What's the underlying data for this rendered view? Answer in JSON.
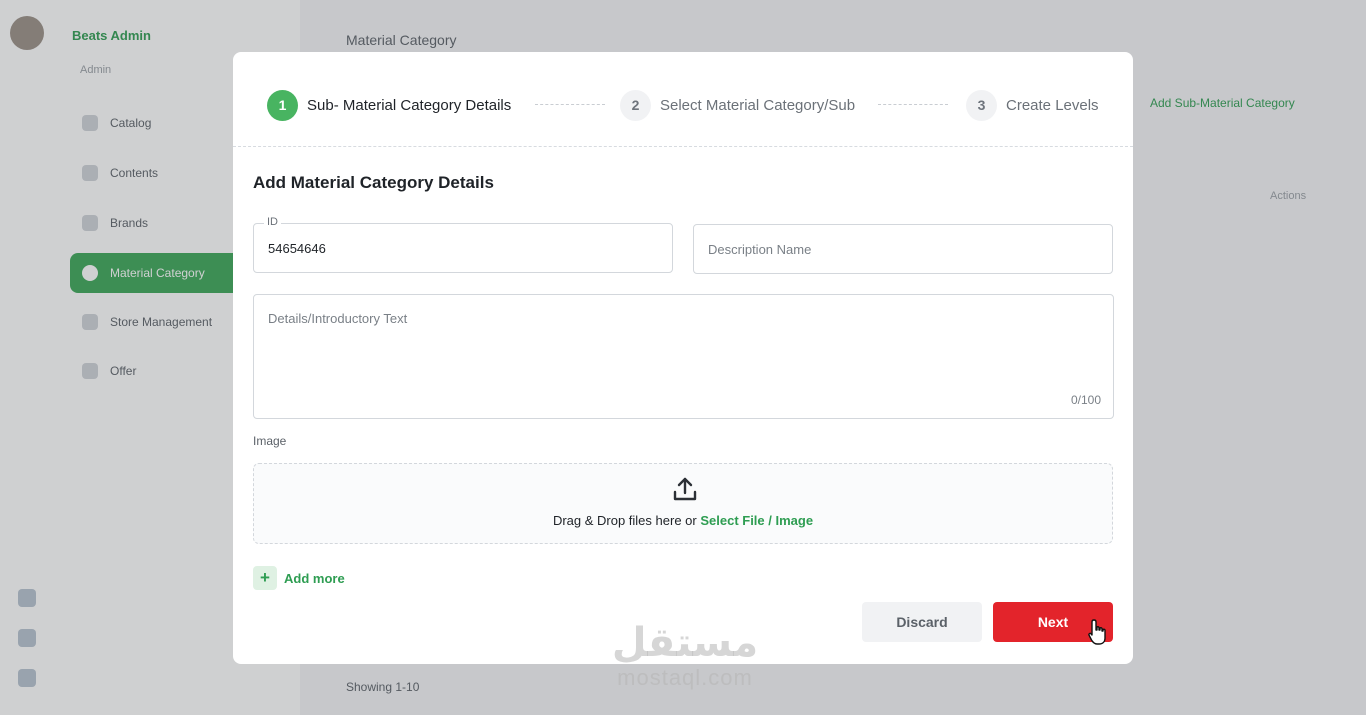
{
  "background": {
    "brand": "Beats Admin",
    "subtitle": "Admin",
    "nav": [
      {
        "label": "Catalog"
      },
      {
        "label": "Contents"
      },
      {
        "label": "Brands"
      },
      {
        "label": "Material Category"
      },
      {
        "label": "Store Management"
      },
      {
        "label": "Offer"
      }
    ],
    "main_title": "Material Category",
    "main_button": "Add Sub-Material Category",
    "main_field": "Actions",
    "footer": "Showing 1-10"
  },
  "stepper": {
    "steps": [
      {
        "number": "1",
        "label": "Sub- Material Category Details"
      },
      {
        "number": "2",
        "label": "Select Material Category/Sub"
      },
      {
        "number": "3",
        "label": "Create Levels"
      }
    ],
    "active_step": 1
  },
  "form": {
    "title": "Add Material Category Details",
    "id_label": "ID",
    "id_value": "54654646",
    "description_placeholder": "Description Name",
    "details_placeholder": "Details/Introductory Text",
    "counter": "0/100",
    "image_label": "Image",
    "dropzone_text": "Drag & Drop files here or",
    "dropzone_link": "Select File / Image",
    "add_more": "Add more"
  },
  "actions": {
    "discard": "Discard",
    "next": "Next"
  },
  "watermark": {
    "arabic": "مستقل",
    "latin": "mostaql.com"
  },
  "colors": {
    "accent": "#48b461",
    "primary_button": "#e3242b",
    "link": "#2e9d52"
  }
}
